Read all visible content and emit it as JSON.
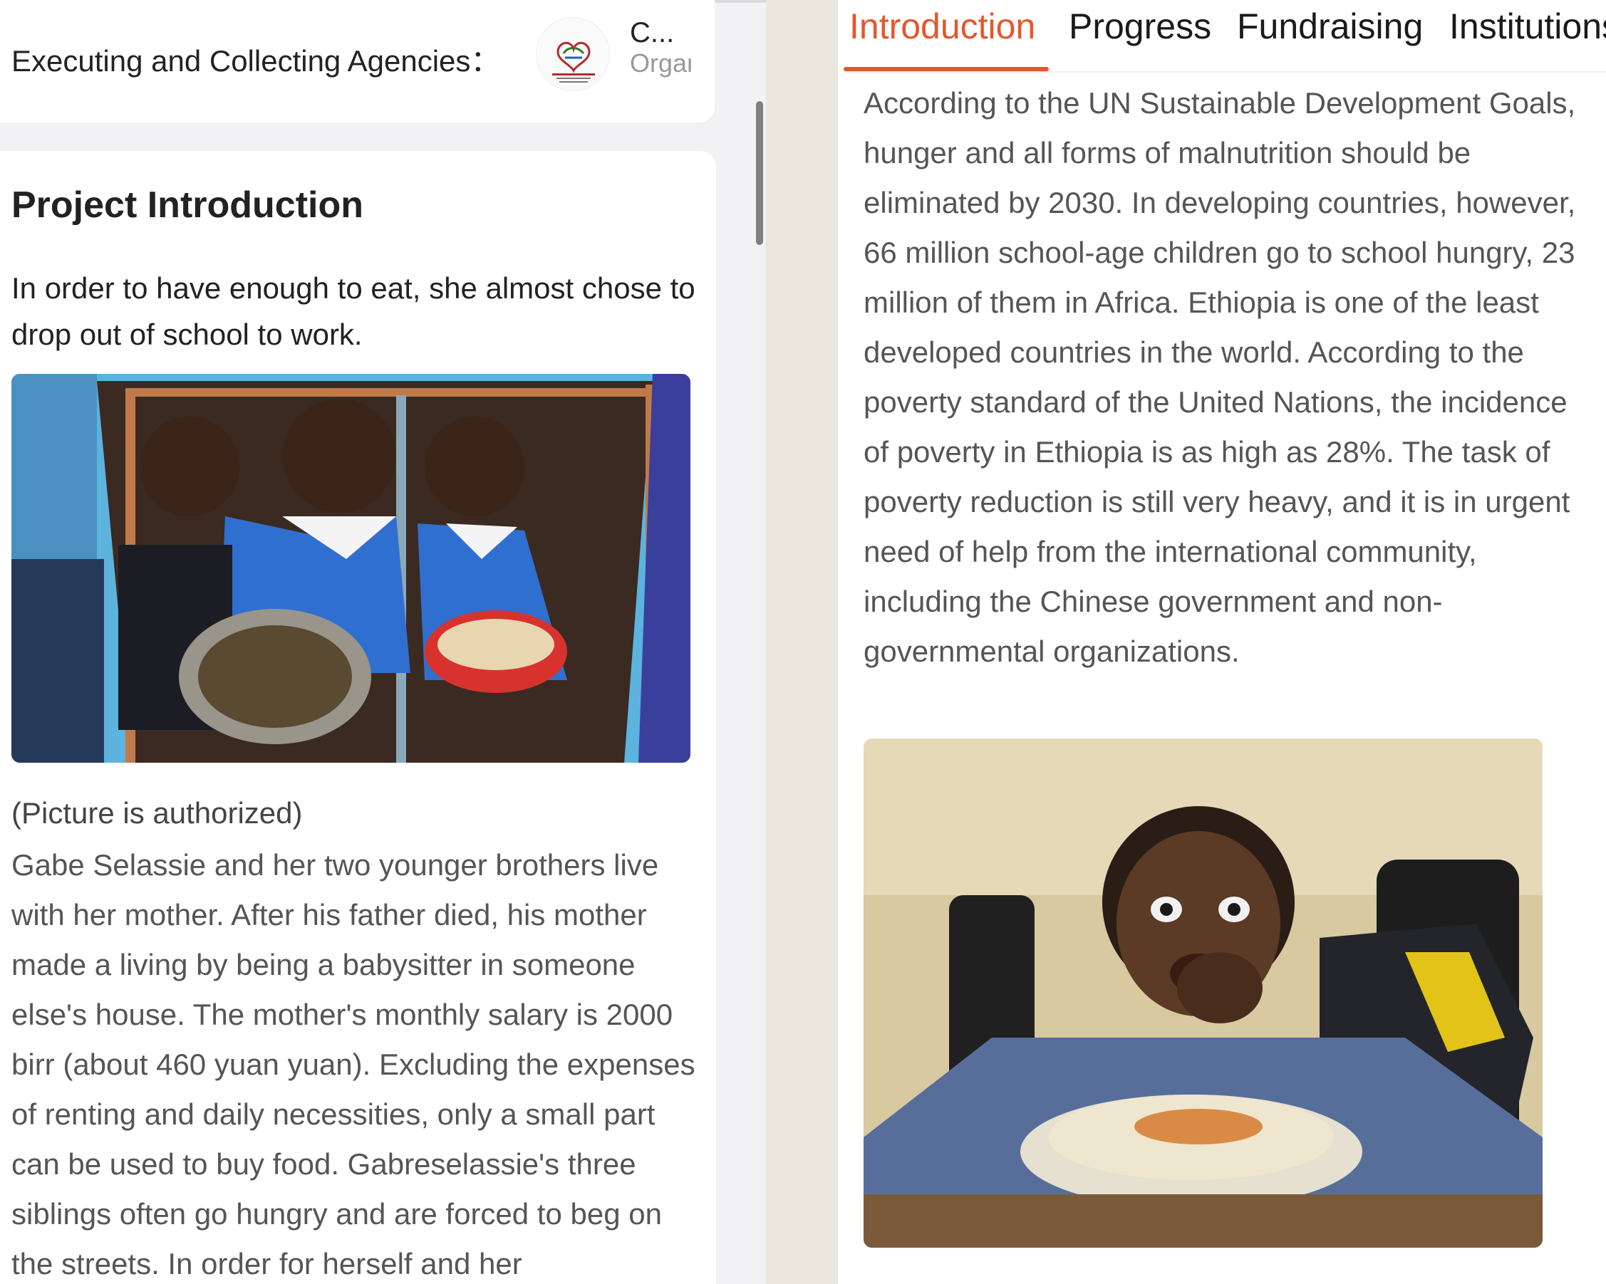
{
  "agency": {
    "label": "Executing and Collecting Agencies：",
    "name_short": "C...",
    "name_sub": "Organizing"
  },
  "project": {
    "title": "Project Introduction",
    "lead": "In order to have enough to eat, she almost chose to drop out of school to work.",
    "caption": "(Picture is authorized)",
    "story": "Gabe Selassie and her two younger brothers live with her mother. After his father died, his mother made a living by being a babysitter in someone else's house. The mother's monthly salary is 2000 birr (about 460 yuan yuan). Excluding the expenses of renting and daily necessities, only a small part can be used to buy food. Gabreselassie's three siblings often go hungry and are forced to beg on the streets. In order for herself and her"
  },
  "tabs": [
    {
      "label": "Introduction",
      "active": true
    },
    {
      "label": "Progress",
      "active": false
    },
    {
      "label": "Fundraising",
      "active": false
    },
    {
      "label": "Institutions",
      "active": false
    }
  ],
  "intro_text": "According to the UN Sustainable Development Goals, hunger and all forms of malnutrition should be eliminated by 2030. In developing countries, however, 66 million school-age children go to school hungry, 23 million of them in Africa. Ethiopia is one of the least developed countries in the world. According to the poverty standard of the United Nations, the incidence of poverty in Ethiopia is as high as 28%. The task of poverty reduction is still very heavy, and it is in urgent need of help from the international community, including the Chinese government and non-governmental organizations.",
  "colors": {
    "accent": "#e4572e",
    "text_dark": "#222222",
    "text_gray": "#555555"
  }
}
